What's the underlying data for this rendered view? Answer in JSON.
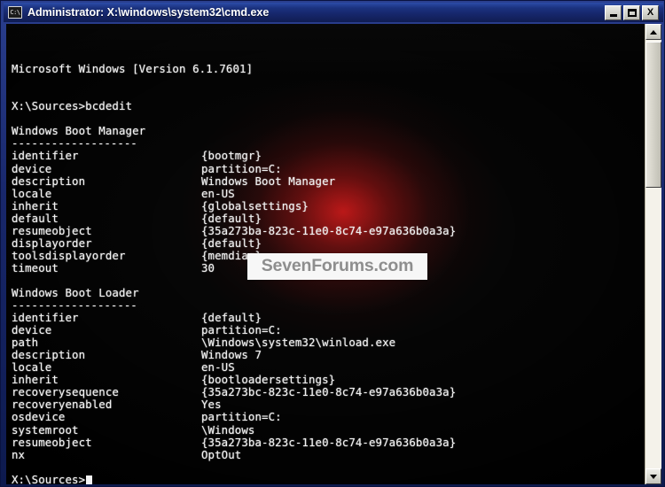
{
  "window": {
    "title": "Administrator: X:\\windows\\system32\\cmd.exe",
    "icon_label": "C:\\",
    "icon_name": "cmd-console-icon",
    "buttons": {
      "minimize": "Minimize",
      "maximize": "Maximize",
      "close": "X"
    }
  },
  "watermark": {
    "text": "SevenForums.com",
    "color": "#8e8e8e"
  },
  "scrollbar": {
    "up_arrow": "▲",
    "down_arrow": "▼"
  },
  "console": {
    "background": "#000000",
    "foreground": "#f2f2f2",
    "glow_color": "#c81212",
    "version_line": "Microsoft Windows [Version 6.1.7601]",
    "prompt_command": "X:\\Sources>bcdedit",
    "final_prompt": "X:\\Sources>",
    "rule": "-------------------",
    "sections": [
      {
        "heading": "Windows Boot Manager",
        "entries": [
          {
            "key": "identifier",
            "value": "{bootmgr}"
          },
          {
            "key": "device",
            "value": "partition=C:"
          },
          {
            "key": "description",
            "value": "Windows Boot Manager"
          },
          {
            "key": "locale",
            "value": "en-US"
          },
          {
            "key": "inherit",
            "value": "{globalsettings}"
          },
          {
            "key": "default",
            "value": "{default}"
          },
          {
            "key": "resumeobject",
            "value": "{35a273ba-823c-11e0-8c74-e97a636b0a3a}"
          },
          {
            "key": "displayorder",
            "value": "{default}"
          },
          {
            "key": "toolsdisplayorder",
            "value": "{memdiag}"
          },
          {
            "key": "timeout",
            "value": "30"
          }
        ]
      },
      {
        "heading": "Windows Boot Loader",
        "entries": [
          {
            "key": "identifier",
            "value": "{default}"
          },
          {
            "key": "device",
            "value": "partition=C:"
          },
          {
            "key": "path",
            "value": "\\Windows\\system32\\winload.exe"
          },
          {
            "key": "description",
            "value": "Windows 7"
          },
          {
            "key": "locale",
            "value": "en-US"
          },
          {
            "key": "inherit",
            "value": "{bootloadersettings}"
          },
          {
            "key": "recoverysequence",
            "value": "{35a273bc-823c-11e0-8c74-e97a636b0a3a}"
          },
          {
            "key": "recoveryenabled",
            "value": "Yes"
          },
          {
            "key": "osdevice",
            "value": "partition=C:"
          },
          {
            "key": "systemroot",
            "value": "\\Windows"
          },
          {
            "key": "resumeobject",
            "value": "{35a273ba-823c-11e0-8c74-e97a636b0a3a}"
          },
          {
            "key": "nx",
            "value": "OptOut"
          }
        ]
      }
    ]
  }
}
